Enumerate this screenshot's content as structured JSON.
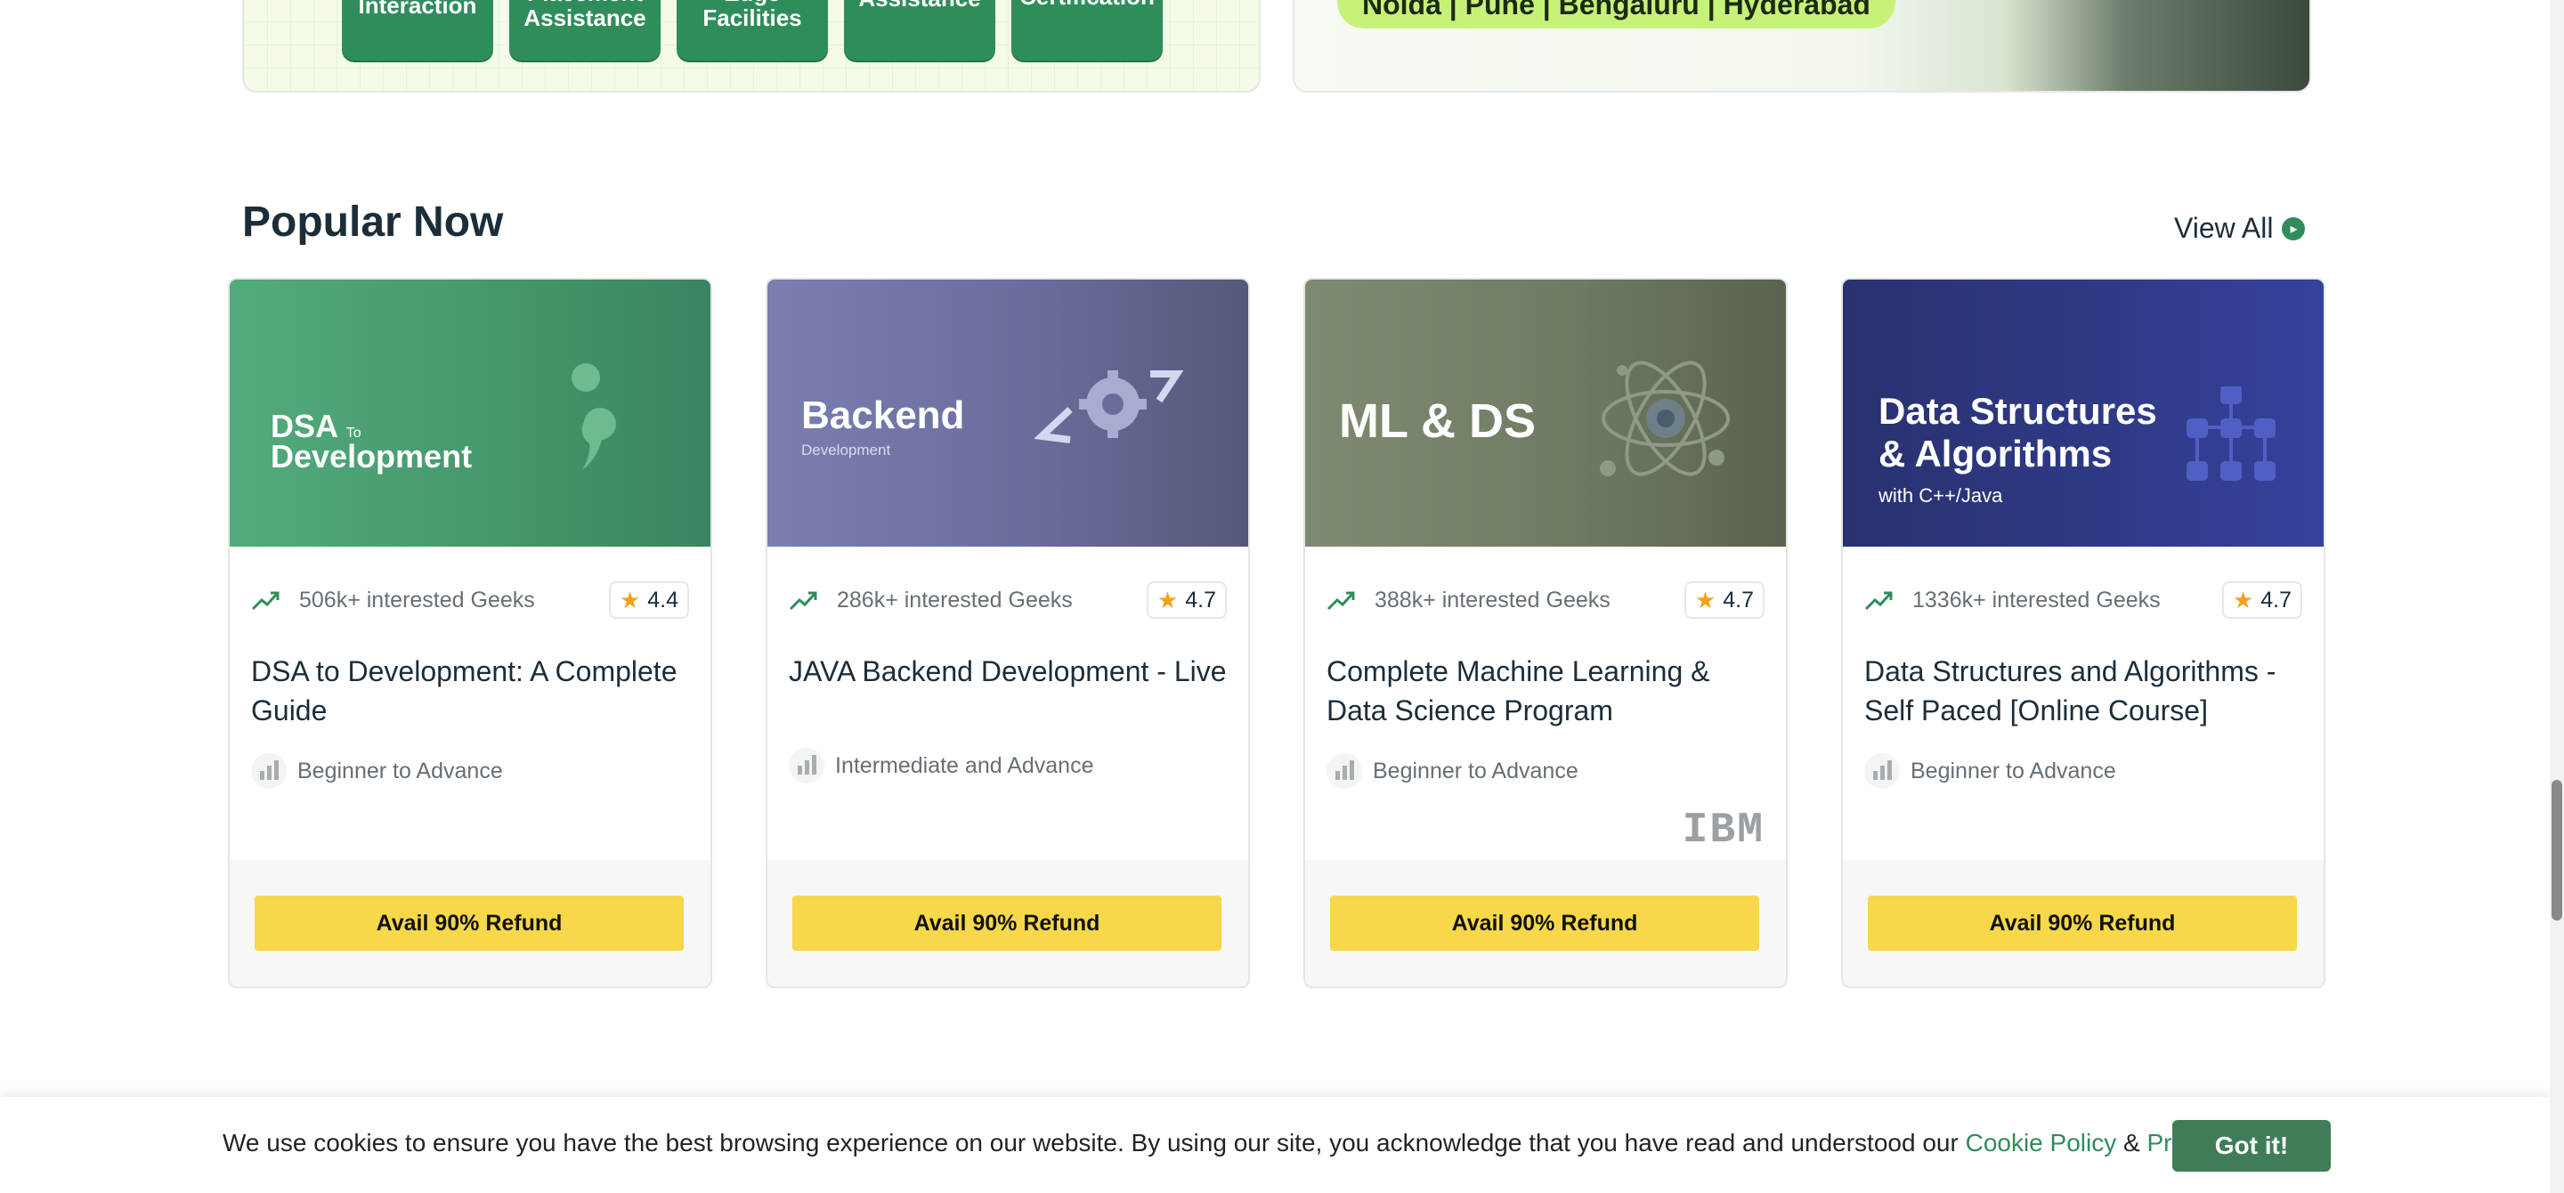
{
  "top_banner_left": {
    "pills": [
      "Interaction",
      "Placement\nAssistance",
      "Edge\nFacilities",
      "Assistance",
      "Certification"
    ]
  },
  "top_banner_right": {
    "cities": "Noida | Pune | Bengaluru | Hyderabad"
  },
  "section": {
    "title": "Popular Now",
    "view_all": "View All"
  },
  "cards": [
    {
      "thumb_title": "DSA",
      "thumb_small": "To",
      "thumb_sub": "Development",
      "interest": "506k+ interested Geeks",
      "rating": "4.4",
      "title": "DSA to Development: A Complete Guide",
      "level": "Beginner to Advance",
      "button": "Avail 90% Refund"
    },
    {
      "thumb_title": "Backend",
      "thumb_sub": "Development",
      "interest": "286k+ interested Geeks",
      "rating": "4.7",
      "title": "JAVA Backend Development - Live",
      "level": "Intermediate and Advance",
      "button": "Avail 90% Refund"
    },
    {
      "thumb_title": "ML & DS",
      "interest": "388k+ interested Geeks",
      "rating": "4.7",
      "title": "Complete Machine Learning & Data Science Program",
      "level": "Beginner to Advance",
      "partner_logo": "IBM",
      "button": "Avail 90% Refund"
    },
    {
      "thumb_title_1": "Data Structures",
      "thumb_title_2": "& Algorithms",
      "thumb_sub": "with C++/Java",
      "interest": "1336k+ interested Geeks",
      "rating": "4.7",
      "title": "Data Structures and Algorithms - Self Paced [Online Course]",
      "level": "Beginner to Advance",
      "button": "Avail 90% Refund"
    }
  ],
  "cookie": {
    "text": "We use cookies to ensure you have the best browsing experience on our website. By using our site, you acknowledge that you have read and understood our ",
    "cookie_policy": "Cookie Policy",
    "amp": " & ",
    "privacy_policy": "Privacy Policy",
    "button": "Got it!"
  },
  "colors": {
    "brand_green": "#2f8d5b",
    "button_yellow": "#f6d84a",
    "card1": "#4aa374",
    "card2": "#6d72a6",
    "card3": "#6f7d62",
    "card4": "#2e3a86"
  },
  "icons": [
    "trending-up-icon",
    "star-icon",
    "level-bars-icon",
    "arrow-right-circle-icon",
    "semicolon-icon",
    "gear-icon",
    "atom-icon",
    "hierarchy-icon"
  ]
}
